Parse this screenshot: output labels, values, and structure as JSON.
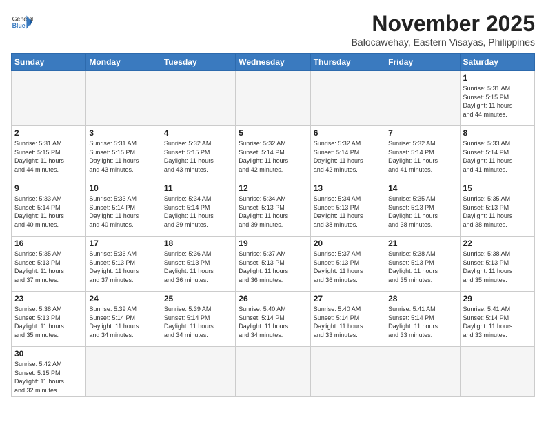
{
  "header": {
    "logo_text_general": "General",
    "logo_text_blue": "Blue",
    "title": "November 2025",
    "subtitle": "Balocawehay, Eastern Visayas, Philippines"
  },
  "weekdays": [
    "Sunday",
    "Monday",
    "Tuesday",
    "Wednesday",
    "Thursday",
    "Friday",
    "Saturday"
  ],
  "weeks": [
    [
      {
        "day": "",
        "info": ""
      },
      {
        "day": "",
        "info": ""
      },
      {
        "day": "",
        "info": ""
      },
      {
        "day": "",
        "info": ""
      },
      {
        "day": "",
        "info": ""
      },
      {
        "day": "",
        "info": ""
      },
      {
        "day": "1",
        "info": "Sunrise: 5:31 AM\nSunset: 5:15 PM\nDaylight: 11 hours\nand 44 minutes."
      }
    ],
    [
      {
        "day": "2",
        "info": "Sunrise: 5:31 AM\nSunset: 5:15 PM\nDaylight: 11 hours\nand 44 minutes."
      },
      {
        "day": "3",
        "info": "Sunrise: 5:31 AM\nSunset: 5:15 PM\nDaylight: 11 hours\nand 43 minutes."
      },
      {
        "day": "4",
        "info": "Sunrise: 5:32 AM\nSunset: 5:15 PM\nDaylight: 11 hours\nand 43 minutes."
      },
      {
        "day": "5",
        "info": "Sunrise: 5:32 AM\nSunset: 5:14 PM\nDaylight: 11 hours\nand 42 minutes."
      },
      {
        "day": "6",
        "info": "Sunrise: 5:32 AM\nSunset: 5:14 PM\nDaylight: 11 hours\nand 42 minutes."
      },
      {
        "day": "7",
        "info": "Sunrise: 5:32 AM\nSunset: 5:14 PM\nDaylight: 11 hours\nand 41 minutes."
      },
      {
        "day": "8",
        "info": "Sunrise: 5:33 AM\nSunset: 5:14 PM\nDaylight: 11 hours\nand 41 minutes."
      }
    ],
    [
      {
        "day": "9",
        "info": "Sunrise: 5:33 AM\nSunset: 5:14 PM\nDaylight: 11 hours\nand 40 minutes."
      },
      {
        "day": "10",
        "info": "Sunrise: 5:33 AM\nSunset: 5:14 PM\nDaylight: 11 hours\nand 40 minutes."
      },
      {
        "day": "11",
        "info": "Sunrise: 5:34 AM\nSunset: 5:14 PM\nDaylight: 11 hours\nand 39 minutes."
      },
      {
        "day": "12",
        "info": "Sunrise: 5:34 AM\nSunset: 5:13 PM\nDaylight: 11 hours\nand 39 minutes."
      },
      {
        "day": "13",
        "info": "Sunrise: 5:34 AM\nSunset: 5:13 PM\nDaylight: 11 hours\nand 38 minutes."
      },
      {
        "day": "14",
        "info": "Sunrise: 5:35 AM\nSunset: 5:13 PM\nDaylight: 11 hours\nand 38 minutes."
      },
      {
        "day": "15",
        "info": "Sunrise: 5:35 AM\nSunset: 5:13 PM\nDaylight: 11 hours\nand 38 minutes."
      }
    ],
    [
      {
        "day": "16",
        "info": "Sunrise: 5:35 AM\nSunset: 5:13 PM\nDaylight: 11 hours\nand 37 minutes."
      },
      {
        "day": "17",
        "info": "Sunrise: 5:36 AM\nSunset: 5:13 PM\nDaylight: 11 hours\nand 37 minutes."
      },
      {
        "day": "18",
        "info": "Sunrise: 5:36 AM\nSunset: 5:13 PM\nDaylight: 11 hours\nand 36 minutes."
      },
      {
        "day": "19",
        "info": "Sunrise: 5:37 AM\nSunset: 5:13 PM\nDaylight: 11 hours\nand 36 minutes."
      },
      {
        "day": "20",
        "info": "Sunrise: 5:37 AM\nSunset: 5:13 PM\nDaylight: 11 hours\nand 36 minutes."
      },
      {
        "day": "21",
        "info": "Sunrise: 5:38 AM\nSunset: 5:13 PM\nDaylight: 11 hours\nand 35 minutes."
      },
      {
        "day": "22",
        "info": "Sunrise: 5:38 AM\nSunset: 5:13 PM\nDaylight: 11 hours\nand 35 minutes."
      }
    ],
    [
      {
        "day": "23",
        "info": "Sunrise: 5:38 AM\nSunset: 5:13 PM\nDaylight: 11 hours\nand 35 minutes."
      },
      {
        "day": "24",
        "info": "Sunrise: 5:39 AM\nSunset: 5:14 PM\nDaylight: 11 hours\nand 34 minutes."
      },
      {
        "day": "25",
        "info": "Sunrise: 5:39 AM\nSunset: 5:14 PM\nDaylight: 11 hours\nand 34 minutes."
      },
      {
        "day": "26",
        "info": "Sunrise: 5:40 AM\nSunset: 5:14 PM\nDaylight: 11 hours\nand 34 minutes."
      },
      {
        "day": "27",
        "info": "Sunrise: 5:40 AM\nSunset: 5:14 PM\nDaylight: 11 hours\nand 33 minutes."
      },
      {
        "day": "28",
        "info": "Sunrise: 5:41 AM\nSunset: 5:14 PM\nDaylight: 11 hours\nand 33 minutes."
      },
      {
        "day": "29",
        "info": "Sunrise: 5:41 AM\nSunset: 5:14 PM\nDaylight: 11 hours\nand 33 minutes."
      }
    ],
    [
      {
        "day": "30",
        "info": "Sunrise: 5:42 AM\nSunset: 5:15 PM\nDaylight: 11 hours\nand 32 minutes."
      },
      {
        "day": "",
        "info": ""
      },
      {
        "day": "",
        "info": ""
      },
      {
        "day": "",
        "info": ""
      },
      {
        "day": "",
        "info": ""
      },
      {
        "day": "",
        "info": ""
      },
      {
        "day": "",
        "info": ""
      }
    ]
  ]
}
